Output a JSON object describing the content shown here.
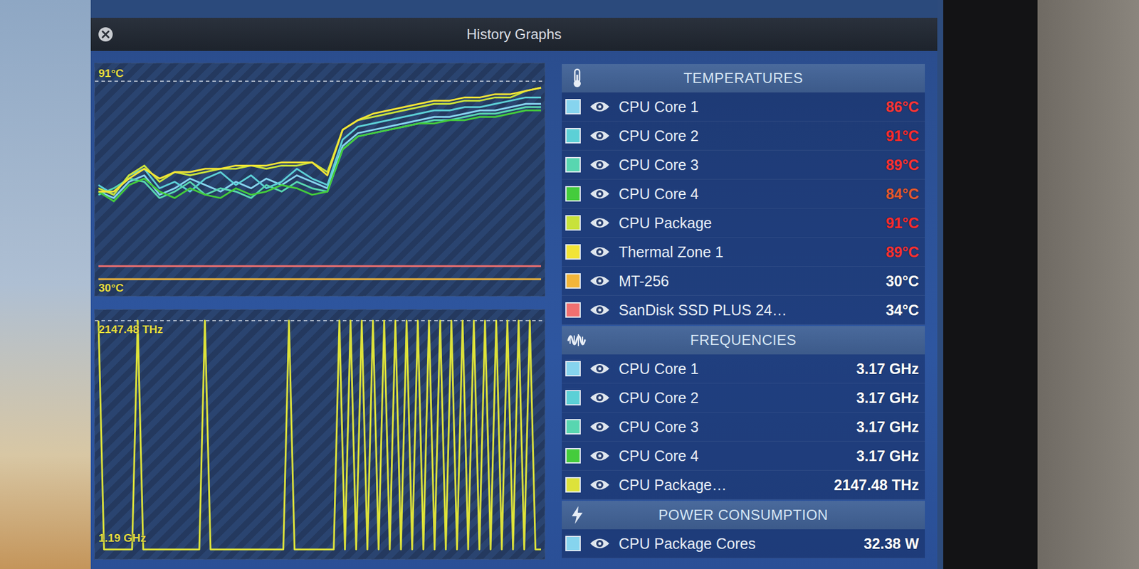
{
  "window": {
    "title": "History Graphs"
  },
  "charts": [
    {
      "kind": "temperature",
      "max_label": "91°C",
      "min_label": "30°C",
      "min": 30,
      "max": 91,
      "series": [
        {
          "color": "#86d4ee",
          "values": [
            57,
            55,
            60,
            62,
            56,
            58,
            61,
            59,
            57,
            60,
            58,
            61,
            59,
            62,
            60,
            58,
            71,
            75,
            76,
            77,
            78,
            79,
            80,
            80,
            81,
            82,
            82,
            83,
            84,
            84
          ]
        },
        {
          "color": "#5cd0d6",
          "values": [
            59,
            56,
            62,
            64,
            58,
            60,
            57,
            61,
            63,
            59,
            62,
            58,
            60,
            64,
            61,
            59,
            73,
            77,
            78,
            79,
            80,
            81,
            82,
            82,
            83,
            83,
            84,
            85,
            86,
            86
          ]
        },
        {
          "color": "#58d6b0",
          "values": [
            56,
            58,
            61,
            60,
            55,
            57,
            60,
            56,
            58,
            57,
            55,
            59,
            57,
            60,
            58,
            57,
            70,
            74,
            75,
            76,
            77,
            78,
            79,
            79,
            80,
            81,
            81,
            82,
            83,
            83
          ]
        },
        {
          "color": "#44cc3c",
          "values": [
            57,
            54,
            59,
            61,
            57,
            55,
            58,
            56,
            55,
            58,
            56,
            57,
            59,
            58,
            56,
            57,
            70,
            74,
            75,
            76,
            77,
            78,
            78,
            79,
            79,
            80,
            80,
            81,
            82,
            82
          ]
        },
        {
          "color": "#c8e23a",
          "values": [
            58,
            56,
            62,
            65,
            60,
            63,
            62,
            63,
            64,
            64,
            65,
            64,
            65,
            65,
            66,
            63,
            76,
            79,
            80,
            81,
            82,
            83,
            84,
            84,
            85,
            85,
            86,
            86,
            88,
            89
          ]
        },
        {
          "color": "#f2e436",
          "values": [
            57,
            57,
            61,
            64,
            61,
            63,
            63,
            64,
            64,
            65,
            65,
            65,
            66,
            66,
            66,
            62,
            76,
            79,
            81,
            82,
            83,
            84,
            85,
            85,
            86,
            86,
            87,
            87,
            88,
            89
          ]
        },
        {
          "color": "#f2b53a",
          "values": [
            30,
            30,
            30,
            30,
            30,
            30,
            30,
            30,
            30,
            30,
            30,
            30,
            30,
            30,
            30,
            30,
            30,
            30,
            30,
            30,
            30,
            30,
            30,
            30,
            30,
            30,
            30,
            30,
            30,
            30
          ]
        },
        {
          "color": "#f07070",
          "values": [
            34,
            34,
            34,
            34,
            34,
            34,
            34,
            34,
            34,
            34,
            34,
            34,
            34,
            34,
            34,
            34,
            34,
            34,
            34,
            34,
            34,
            34,
            34,
            34,
            34,
            34,
            34,
            34,
            34,
            34
          ]
        }
      ]
    },
    {
      "kind": "frequency",
      "max_label": "2147.48 THz",
      "min_label": "1.19 GHz",
      "min": 1.19,
      "max": 2147480,
      "series": [
        {
          "color": "#dde23a",
          "values": [
            2147480,
            1.19,
            1.19,
            1.19,
            1.19,
            1.19,
            1.19,
            2147480,
            1.19,
            1.19,
            1.19,
            1.19,
            1.19,
            1.19,
            1.19,
            1.19,
            1.19,
            1.19,
            1.19,
            2147480,
            1.19,
            1.19,
            1.19,
            1.19,
            1.19,
            1.19,
            1.19,
            1.19,
            1.19,
            1.19,
            1.19,
            1.19,
            1.19,
            1.19,
            2147480,
            1.19,
            1.19,
            1.19,
            1.19,
            1.19,
            1.19,
            1.19,
            1.19,
            2147480,
            1.19,
            2147480,
            1.19,
            2147480,
            1.19,
            2147480,
            1.19,
            2147480,
            1.19,
            2147480,
            1.19,
            2147480,
            1.19,
            2147480,
            1.19,
            2147480,
            1.19,
            2147480,
            1.19,
            2147480,
            1.19,
            2147480,
            1.19,
            2147480,
            1.19,
            2147480,
            1.19,
            2147480,
            1.19,
            2147480,
            1.19,
            2147480,
            1.19,
            2147480,
            1.19,
            1.19
          ]
        }
      ]
    }
  ],
  "sections": [
    {
      "title": "TEMPERATURES",
      "kind": "temperature",
      "items": [
        {
          "label": "CPU Core 1",
          "value": "86°C",
          "color": "#86d4ee",
          "value_color": "#ff3434",
          "visible": true
        },
        {
          "label": "CPU Core 2",
          "value": "91°C",
          "color": "#5cd0d6",
          "value_color": "#ff2a2a",
          "visible": true
        },
        {
          "label": "CPU Core 3",
          "value": "89°C",
          "color": "#58d6b0",
          "value_color": "#ff3030",
          "visible": true
        },
        {
          "label": "CPU Core 4",
          "value": "84°C",
          "color": "#44cc3c",
          "value_color": "#e4582c",
          "visible": true
        },
        {
          "label": "CPU Package",
          "value": "91°C",
          "color": "#c8e23a",
          "value_color": "#ff2a2a",
          "visible": true
        },
        {
          "label": "Thermal Zone 1",
          "value": "89°C",
          "color": "#f2e436",
          "value_color": "#ff3030",
          "visible": true
        },
        {
          "label": "MT-256",
          "value": "30°C",
          "color": "#f2b53a",
          "value_color": "#ffffff",
          "visible": true
        },
        {
          "label": "SanDisk SSD PLUS 24…",
          "value": "34°C",
          "color": "#f07070",
          "value_color": "#ffffff",
          "visible": true
        }
      ]
    },
    {
      "title": "FREQUENCIES",
      "kind": "frequency",
      "items": [
        {
          "label": "CPU Core 1",
          "value": "3.17 GHz",
          "color": "#86d4ee",
          "value_color": "#ffffff",
          "visible": true
        },
        {
          "label": "CPU Core 2",
          "value": "3.17 GHz",
          "color": "#5cd0d6",
          "value_color": "#ffffff",
          "visible": true
        },
        {
          "label": "CPU Core 3",
          "value": "3.17 GHz",
          "color": "#58d6b0",
          "value_color": "#ffffff",
          "visible": true
        },
        {
          "label": "CPU Core 4",
          "value": "3.17 GHz",
          "color": "#44cc3c",
          "value_color": "#ffffff",
          "visible": true
        },
        {
          "label": "CPU Package…",
          "value": "2147.48 THz",
          "color": "#dde23a",
          "value_color": "#ffffff",
          "visible": true
        }
      ]
    },
    {
      "title": "POWER CONSUMPTION",
      "kind": "power",
      "items": [
        {
          "label": "CPU Package Cores",
          "value": "32.38 W",
          "color": "#86d4ee",
          "value_color": "#ffffff",
          "visible": true
        }
      ]
    }
  ]
}
